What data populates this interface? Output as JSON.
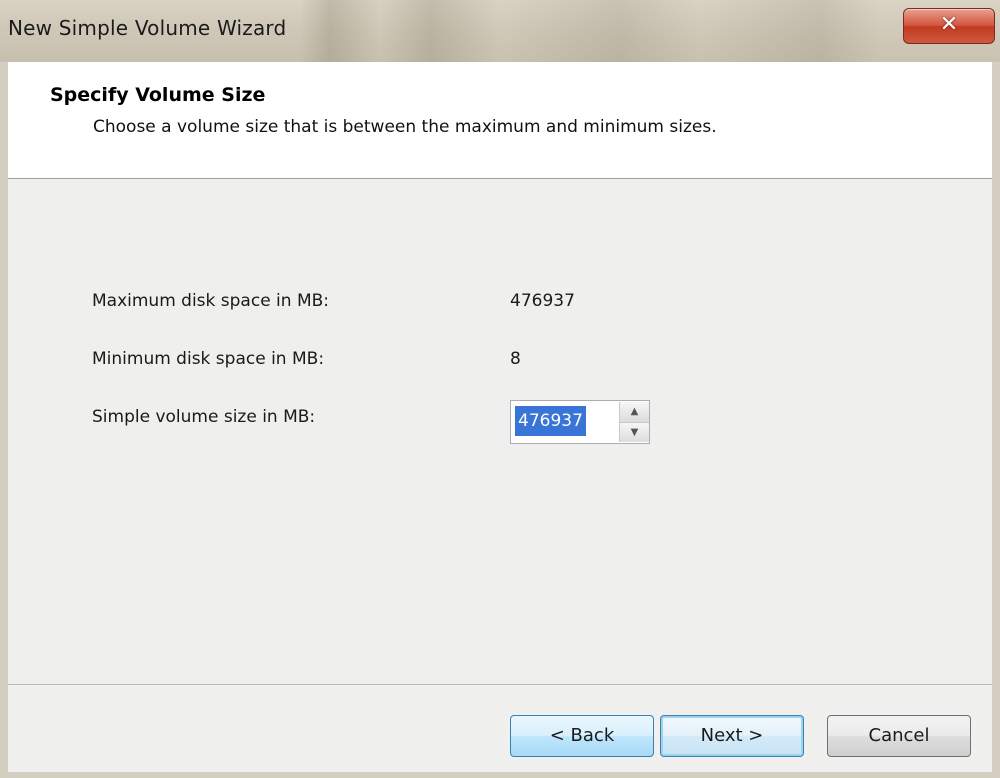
{
  "window": {
    "title": "New Simple Volume Wizard",
    "close_glyph": "✕"
  },
  "header": {
    "title": "Specify Volume Size",
    "subtitle": "Choose a volume size that is between the maximum and minimum sizes."
  },
  "fields": {
    "max_label": "Maximum disk space in MB:",
    "max_value": "476937",
    "min_label": "Minimum disk space in MB:",
    "min_value": "8",
    "size_label": "Simple volume size in MB:",
    "size_value": "476937",
    "spin_up_glyph": "▲",
    "spin_down_glyph": "▼"
  },
  "buttons": {
    "back": "< Back",
    "next": "Next >",
    "cancel": "Cancel"
  },
  "colors": {
    "selection": "#3875d7",
    "close_button": "#c03a20"
  },
  "icons": [
    "close-icon",
    "arrow-up-icon",
    "arrow-down-icon"
  ]
}
